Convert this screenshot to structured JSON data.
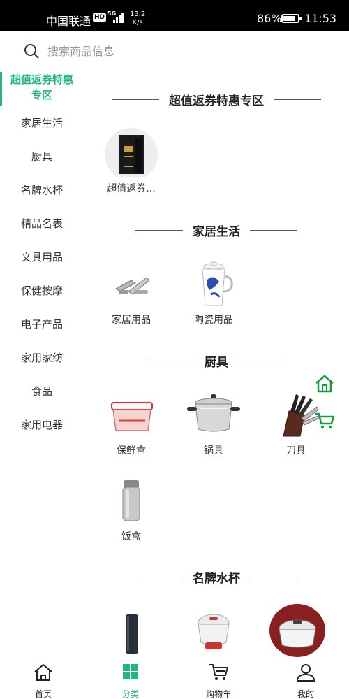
{
  "status_bar": {
    "carrier": "中国联通",
    "hd": "HD",
    "network": "5G",
    "speed_value": "13.2",
    "speed_unit": "K/s",
    "battery_percent": "86%",
    "battery_level": 0.86,
    "time": "11:53"
  },
  "search": {
    "placeholder": "搜索商品信息",
    "icon": "search-icon"
  },
  "sidebar": {
    "active_index": 0,
    "items": [
      {
        "label_line1": "超值返券特惠",
        "label_line2": "专区"
      },
      {
        "label": "家居生活"
      },
      {
        "label": "厨具"
      },
      {
        "label": "名牌水杯"
      },
      {
        "label": "精品名表"
      },
      {
        "label": "文具用品"
      },
      {
        "label": "保健按摩"
      },
      {
        "label": "电子产品"
      },
      {
        "label": "家用家纺"
      },
      {
        "label": "食品"
      },
      {
        "label": "家用电器"
      }
    ]
  },
  "sections": [
    {
      "title": "超值返券特惠专区",
      "products": [
        {
          "label": "超值返券..."
        }
      ]
    },
    {
      "title": "家居生活",
      "products": [
        {
          "label": "家居用品"
        },
        {
          "label": "陶瓷用品"
        }
      ]
    },
    {
      "title": "厨具",
      "products": [
        {
          "label": "保鲜盒"
        },
        {
          "label": "锅具"
        },
        {
          "label": "刀具"
        },
        {
          "label": "饭盒"
        }
      ]
    },
    {
      "title": "名牌水杯",
      "products": []
    }
  ],
  "floating": {
    "home_icon": "home-icon",
    "cart_icon": "cart-icon"
  },
  "bottom_nav": {
    "active_index": 1,
    "items": [
      {
        "label": "首页",
        "icon": "home-icon"
      },
      {
        "label": "分类",
        "icon": "category-icon"
      },
      {
        "label": "购物车",
        "icon": "cart-icon"
      },
      {
        "label": "我的",
        "icon": "user-icon"
      }
    ]
  },
  "colors": {
    "accent": "#1fb77a",
    "status_bar_bg": "#000000",
    "text": "#222222",
    "placeholder": "#9a9a9a",
    "floating_icon": "#1a9a3a"
  }
}
